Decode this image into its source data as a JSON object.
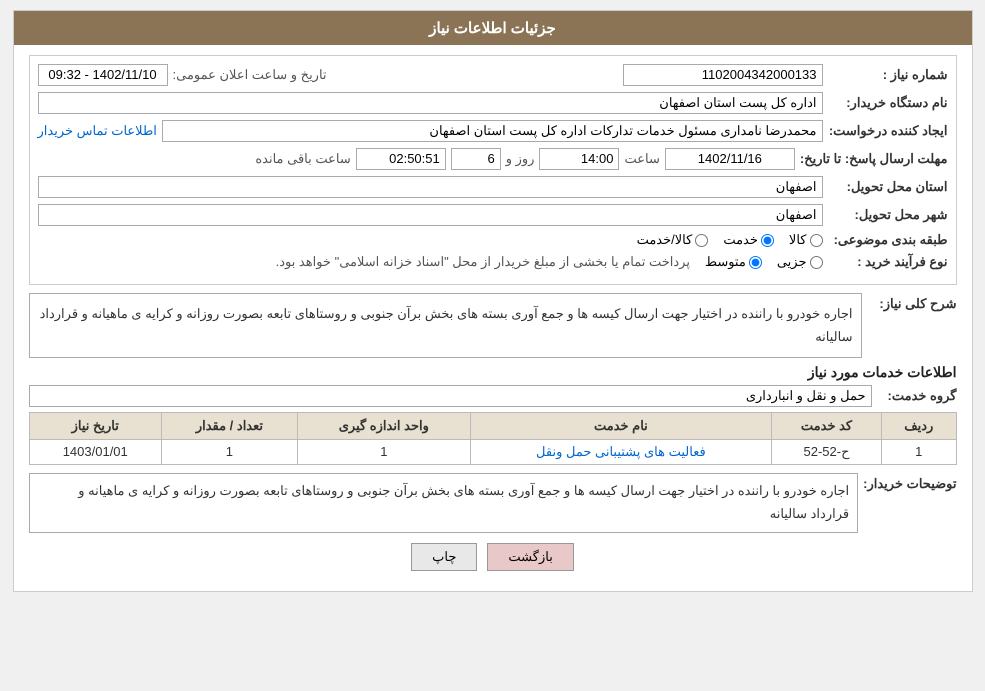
{
  "page": {
    "title": "جزئیات اطلاعات نیاز"
  },
  "fields": {
    "need_number_label": "شماره نیاز :",
    "need_number_value": "1102004342000133",
    "org_name_label": "نام دستگاه خریدار:",
    "org_name_value": "اداره کل پست استان اصفهان",
    "public_announce_label": "تاریخ و ساعت اعلان عمومی:",
    "public_announce_value": "1402/11/10 - 09:32",
    "creator_label": "ایجاد کننده درخواست:",
    "creator_value": "محمدرضا نامداری مسئول خدمات تدارکات اداره کل پست استان اصفهان",
    "creator_link": "اطلاعات تماس خریدار",
    "response_deadline_label": "مهلت ارسال پاسخ: تا تاریخ:",
    "response_date": "1402/11/16",
    "response_time_label": "ساعت",
    "response_time": "14:00",
    "response_days_label": "روز و",
    "response_days": "6",
    "response_remaining_label": "ساعت باقی مانده",
    "response_remaining": "02:50:51",
    "delivery_province_label": "استان محل تحویل:",
    "delivery_province": "اصفهان",
    "delivery_city_label": "شهر محل تحویل:",
    "delivery_city": "اصفهان",
    "subject_type_label": "طبقه بندی موضوعی:",
    "subject_type_options": [
      "کالا",
      "خدمت",
      "کالا/خدمت"
    ],
    "subject_type_selected": "خدمت",
    "purchase_type_label": "نوع فرآیند خرید :",
    "purchase_type_options": [
      "جزیی",
      "متوسط"
    ],
    "purchase_type_selected": "متوسط",
    "purchase_type_note": "پرداخت تمام یا بخشی از مبلغ خریدار از محل \"اسناد خزانه اسلامی\" خواهد بود.",
    "description_label": "شرح کلی نیاز:",
    "description_value": "اجاره خودرو با راننده در اختیار جهت ارسال کیسه ها و جمع آوری بسته های بخش برآن جنوبی و روستاهای تابعه بصورت روزانه و کرایه ی ماهیانه و قرارداد سالیانه",
    "service_info_label": "اطلاعات خدمات مورد نیاز",
    "service_group_label": "گروه خدمت:",
    "service_group_value": "حمل و نقل و انبارداری",
    "table_columns": [
      "ردیف",
      "کد خدمت",
      "نام خدمت",
      "واحد اندازه گیری",
      "تعداد / مقدار",
      "تاریخ نیاز"
    ],
    "table_rows": [
      {
        "row": "1",
        "code": "ح-52-52",
        "name": "فعالیت های پشتیبانی حمل ونقل",
        "unit": "1",
        "qty": "1",
        "date": "1403/01/01"
      }
    ],
    "buyer_notes_label": "توضیحات خریدار:",
    "buyer_notes_value": "اجاره خودرو با راننده در اختیار جهت ارسال کیسه ها و جمع آوری بسته های بخش برآن جنوبی و روستاهای تابعه بصورت روزانه و کرایه ی ماهیانه و قرارداد سالیانه",
    "btn_back": "بازگشت",
    "btn_print": "چاپ"
  }
}
